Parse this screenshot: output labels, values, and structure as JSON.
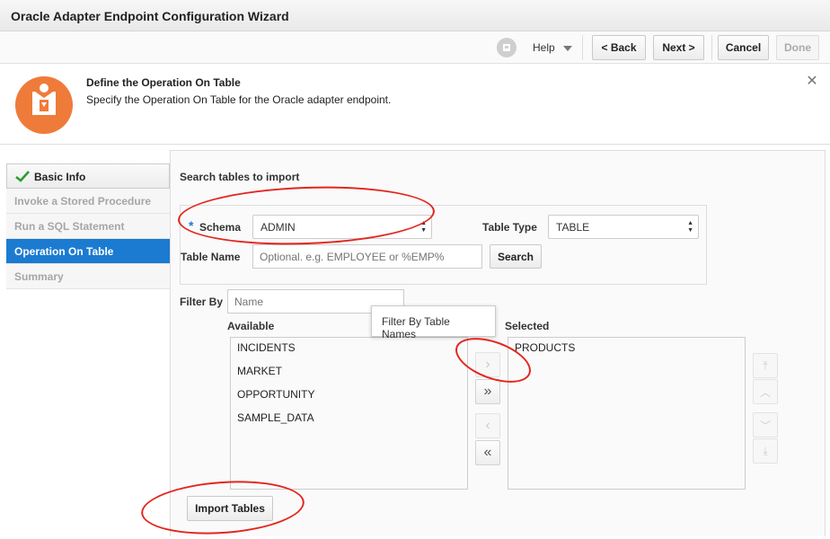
{
  "window": {
    "title": "Oracle Adapter Endpoint Configuration Wizard"
  },
  "toolbar": {
    "help_label": "Help",
    "back_label": "< Back",
    "next_label": "Next >",
    "cancel_label": "Cancel",
    "done_label": "Done"
  },
  "header": {
    "title": "Define the Operation On Table",
    "subtitle": "Specify the Operation On Table for the Oracle adapter endpoint.",
    "close_glyph": "✕",
    "logo_color": "#ef7b3a"
  },
  "sidebar": {
    "items": [
      {
        "label": "Basic Info",
        "state": "completed"
      },
      {
        "label": "Invoke a Stored Procedure",
        "state": "disabled"
      },
      {
        "label": "Run a SQL Statement",
        "state": "disabled"
      },
      {
        "label": "Operation On Table",
        "state": "active"
      },
      {
        "label": "Summary",
        "state": "disabled"
      }
    ]
  },
  "main": {
    "section_title": "Search tables to import",
    "schema": {
      "required_mark": "*",
      "label": "Schema",
      "value": "ADMIN"
    },
    "table_type": {
      "label": "Table Type",
      "value": "TABLE"
    },
    "table_name": {
      "label": "Table Name",
      "placeholder": "Optional. e.g. EMPLOYEE or %EMP%"
    },
    "search_button": "Search",
    "filter": {
      "label": "Filter By",
      "placeholder": "Name"
    },
    "available": {
      "label": "Available",
      "items": [
        "INCIDENTS",
        "MARKET",
        "OPPORTUNITY",
        "SAMPLE_DATA"
      ]
    },
    "selected": {
      "label": "Selected",
      "items": [
        "PRODUCTS"
      ]
    },
    "tooltip": "Filter By Table Names",
    "shuttle": {
      "move_right": "›",
      "move_all_right": "»",
      "move_left": "‹",
      "move_all_left": "«",
      "move_top": "⤒",
      "move_up": "︿",
      "move_down": "﹀",
      "move_bottom": "⤓"
    },
    "import_button": "Import Tables"
  },
  "colors": {
    "accent": "#1b7bd1",
    "annotation": "#e3261f",
    "check": "#2e9b2e"
  }
}
